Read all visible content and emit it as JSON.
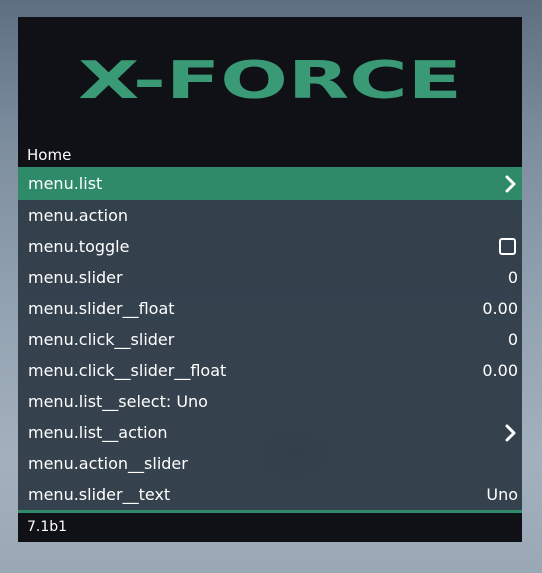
{
  "header": {
    "logo_text": "X-FORCE",
    "logo_color": "#3a9a76"
  },
  "subheader": {
    "title": "Home"
  },
  "colors": {
    "accent": "#2f8a6a",
    "header_bg": "#101116",
    "panel_bg": "#2d3a46",
    "text": "#ffffff"
  },
  "items": [
    {
      "label": "menu.list",
      "value": "",
      "icon": "chevron-right-icon"
    },
    {
      "label": "menu.action",
      "value": ""
    },
    {
      "label": "menu.toggle",
      "value": "",
      "icon": "checkbox-icon"
    },
    {
      "label": "menu.slider",
      "value": "0"
    },
    {
      "label": "menu.slider__float",
      "value": "0.00"
    },
    {
      "label": "menu.click__slider",
      "value": "0"
    },
    {
      "label": "menu.click__slider__float",
      "value": "0.00"
    },
    {
      "label": "menu.list__select: Uno",
      "value": ""
    },
    {
      "label": "menu.list__action",
      "value": "",
      "icon": "chevron-right-icon"
    },
    {
      "label": "menu.action__slider",
      "value": ""
    },
    {
      "label": "menu.slider__text",
      "value": "Uno"
    }
  ],
  "footer": {
    "version": "7.1b1"
  }
}
